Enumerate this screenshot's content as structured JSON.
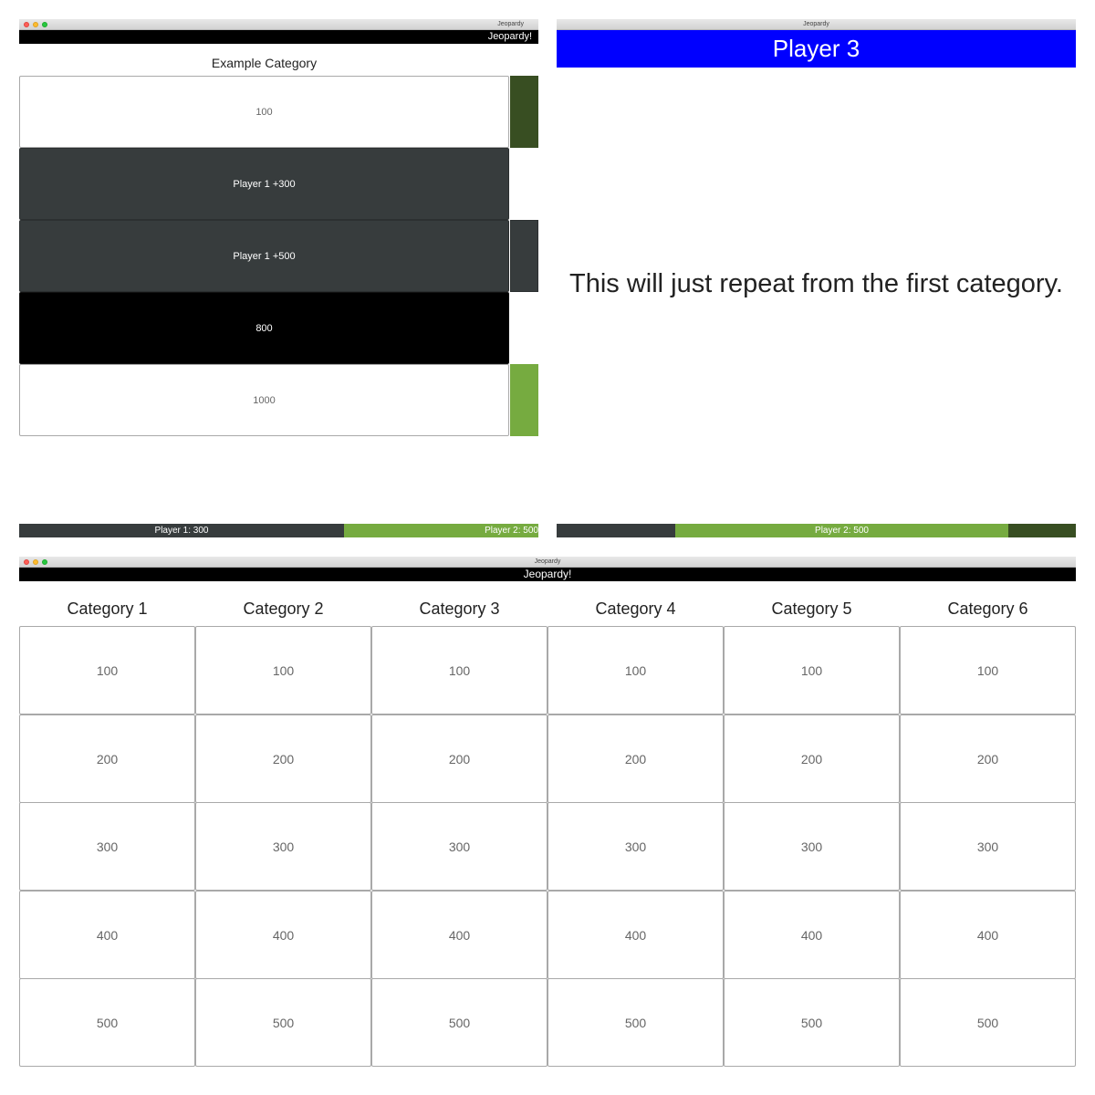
{
  "window_title": "Jeopardy",
  "app_header": "Jeopardy!",
  "category_view": {
    "title": "Example Category",
    "tiles": [
      {
        "label": "100",
        "state": "fresh"
      },
      {
        "label": "Player 1 +300",
        "state": "answered"
      },
      {
        "label": "Player 1 +500",
        "state": "answered"
      },
      {
        "label": "800",
        "state": "active"
      },
      {
        "label": "1000",
        "state": "fresh"
      }
    ],
    "scores": [
      {
        "label": "Player 1: 300"
      },
      {
        "label": "Player 2: 500"
      }
    ]
  },
  "question_view": {
    "player_banner": "Player 3",
    "message": "This will just repeat from the first category.",
    "scores": [
      {
        "label": "Player 2: 500"
      }
    ]
  },
  "board_view": {
    "categories": [
      {
        "name": "Category 1",
        "values": [
          "100",
          "200",
          "300",
          "400",
          "500"
        ]
      },
      {
        "name": "Category 2",
        "values": [
          "100",
          "200",
          "300",
          "400",
          "500"
        ]
      },
      {
        "name": "Category 3",
        "values": [
          "100",
          "200",
          "300",
          "400",
          "500"
        ]
      },
      {
        "name": "Category 4",
        "values": [
          "100",
          "200",
          "300",
          "400",
          "500"
        ]
      },
      {
        "name": "Category 5",
        "values": [
          "100",
          "200",
          "300",
          "400",
          "500"
        ]
      },
      {
        "name": "Category 6",
        "values": [
          "100",
          "200",
          "300",
          "400",
          "500"
        ]
      }
    ]
  },
  "colors": {
    "player_blue": "#0000ff",
    "answered_tile": "#373c3d",
    "player_green": "#76ab40",
    "dark_green": "#384e22"
  }
}
